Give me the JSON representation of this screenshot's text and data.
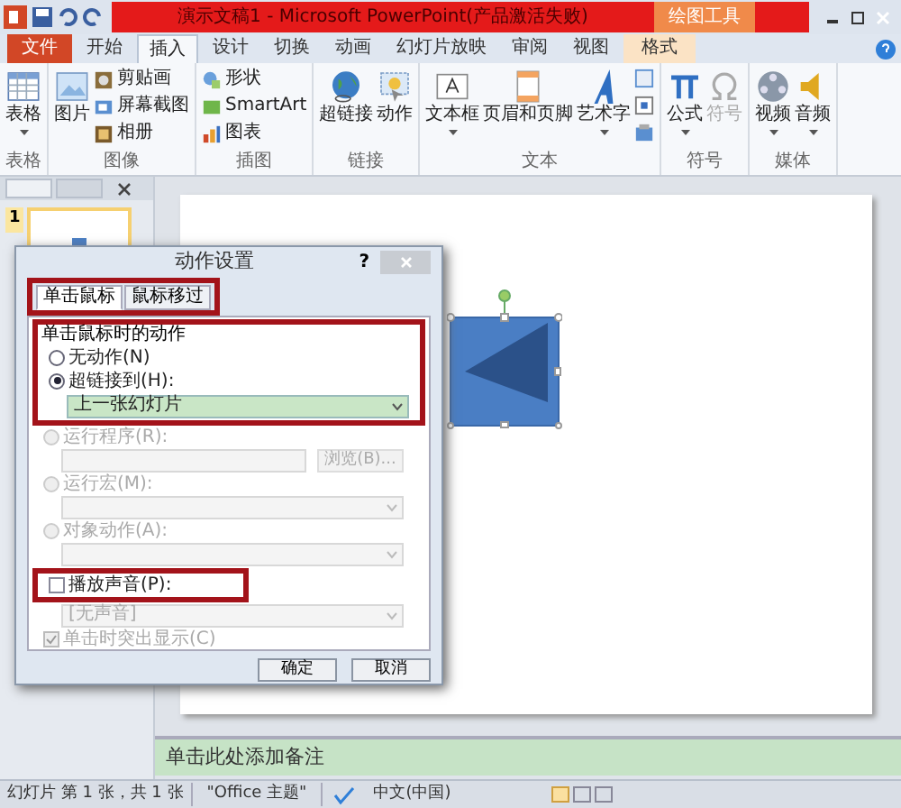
{
  "window": {
    "title": "演示文稿1 - Microsoft PowerPoint(产品激活失败)",
    "context_tab_group": "绘图工具"
  },
  "tabs": [
    {
      "label": "文件",
      "kind": "file",
      "selected": false
    },
    {
      "label": "开始",
      "kind": "normal",
      "selected": false
    },
    {
      "label": "插入",
      "kind": "normal",
      "selected": true
    },
    {
      "label": "设计",
      "kind": "normal",
      "selected": false
    },
    {
      "label": "切换",
      "kind": "normal",
      "selected": false
    },
    {
      "label": "动画",
      "kind": "normal",
      "selected": false
    },
    {
      "label": "幻灯片放映",
      "kind": "normal",
      "selected": false
    },
    {
      "label": "审阅",
      "kind": "normal",
      "selected": false
    },
    {
      "label": "视图",
      "kind": "normal",
      "selected": false
    },
    {
      "label": "格式",
      "kind": "context",
      "selected": false
    }
  ],
  "ribbon_groups": [
    {
      "label": "表格",
      "large": [
        {
          "label": "表格",
          "dropdown": true,
          "disabled": false
        }
      ]
    },
    {
      "label": "图像",
      "large": [
        {
          "label": "图片",
          "dropdown": false,
          "disabled": false
        }
      ],
      "small": [
        {
          "label": "剪贴画"
        },
        {
          "label": "屏幕截图"
        },
        {
          "label": "相册"
        }
      ]
    },
    {
      "label": "插图",
      "small": [
        {
          "label": "形状"
        },
        {
          "label": "SmartArt"
        },
        {
          "label": "图表"
        }
      ]
    },
    {
      "label": "链接",
      "large": [
        {
          "label": "超链接",
          "dropdown": false,
          "disabled": false
        },
        {
          "label": "动作",
          "dropdown": false,
          "disabled": false
        }
      ]
    },
    {
      "label": "文本",
      "large": [
        {
          "label": "文本框",
          "dropdown": true,
          "disabled": false
        },
        {
          "label": "页眉和页脚",
          "dropdown": false,
          "disabled": false
        },
        {
          "label": "艺术字",
          "dropdown": true,
          "disabled": false
        }
      ]
    },
    {
      "label": "符号",
      "large": [
        {
          "label": "公式",
          "dropdown": true,
          "disabled": false
        },
        {
          "label": "符号",
          "dropdown": false,
          "disabled": true
        }
      ]
    },
    {
      "label": "媒体",
      "large": [
        {
          "label": "视频",
          "dropdown": true,
          "disabled": false
        },
        {
          "label": "音频",
          "dropdown": true,
          "disabled": false
        }
      ]
    }
  ],
  "slides_pane": {
    "slide_number": "1"
  },
  "dialog": {
    "title": "动作设置",
    "help": "?",
    "tabs": [
      {
        "label": "单击鼠标",
        "selected": true
      },
      {
        "label": "鼠标移过",
        "selected": false
      }
    ],
    "group_label": "单击鼠标时的动作",
    "rows": [
      {
        "kind": "radio",
        "label": "无动作(N)",
        "selected": false,
        "disabled": false
      },
      {
        "kind": "radio",
        "label": "超链接到(H):",
        "selected": true,
        "disabled": false
      },
      {
        "kind": "select",
        "value": "上一张幻灯片",
        "disabled": false
      },
      {
        "kind": "radio",
        "label": "运行程序(R):",
        "selected": false,
        "disabled": true
      },
      {
        "kind": "browse",
        "button": "浏览(B)...",
        "disabled": true
      },
      {
        "kind": "radio",
        "label": "运行宏(M):",
        "selected": false,
        "disabled": true
      },
      {
        "kind": "select",
        "disabled": true
      },
      {
        "kind": "radio",
        "label": "对象动作(A):",
        "selected": false,
        "disabled": true
      },
      {
        "kind": "select",
        "disabled": true
      },
      {
        "kind": "checkbox",
        "label": "播放声音(P):",
        "checked": false,
        "disabled": false
      },
      {
        "kind": "select",
        "value": "[无声音]",
        "disabled": true
      },
      {
        "kind": "checkbox",
        "label": "单击时突出显示(C)",
        "checked": true,
        "disabled": true
      }
    ],
    "buttons": [
      "确定",
      "取消"
    ]
  },
  "notes": {
    "placeholder": "单击此处添加备注"
  },
  "status_bar": {
    "slide": "幻灯片 第 1 张，共 1 张",
    "theme": "\"Office 主题\"",
    "language": "中文(中国)"
  }
}
